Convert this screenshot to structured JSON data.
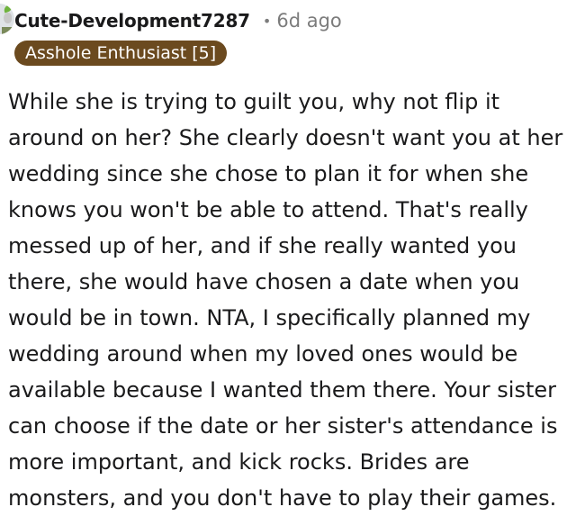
{
  "comment": {
    "username": "Cute-Development7287",
    "timestamp": "6d ago",
    "separator": "•",
    "flair": "Asshole Enthusiast [5]",
    "flair_color": "#6b4a1f",
    "avatar_icon": "snoo-avatar-icon",
    "body": "While she is trying to guilt you, why not flip it around on her? She clearly doesn't want you at her wedding since she chose to plan it for when she knows you won't be able to attend. That's really messed up of her, and if she really wanted you there, she would have chosen a date when you would be in town. NTA, I specifically planned my wedding around when my loved ones would be available because I wanted them there. Your sister can choose if the date or her sister's attendance is more important, and kick rocks. Brides are monsters, and you don't have to play their games."
  }
}
